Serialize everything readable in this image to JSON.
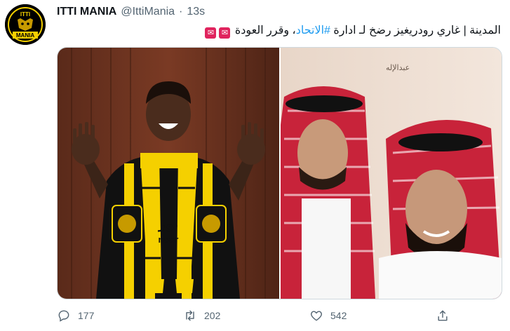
{
  "tweet": {
    "author_name": "ITTI MANIA",
    "handle": "@IttiMania",
    "separator": "·",
    "time": "13s",
    "text_before": "المدينة | غاري رودريغيز رضخ لـ ادارة ",
    "hashtag": "#الاتحاد",
    "text_after": "، وقرر العودة",
    "emoji_name": "red-envelope-emoji",
    "avatar_text": "ITTI MANIA"
  },
  "media": {
    "left_photo": {
      "name": "player-with-scarf-photo",
      "shirt_text": "نور",
      "shirt_text2": "noor",
      "watermark": ""
    },
    "right_photo": {
      "name": "two-men-photo",
      "watermark": "عبدالإله"
    }
  },
  "actions": {
    "reply_count": "177",
    "retweet_count": "202",
    "like_count": "542"
  },
  "colors": {
    "hashtag": "#1d9bf0",
    "secondary_text": "#536471",
    "ittihad_yellow": "#f5d000"
  }
}
